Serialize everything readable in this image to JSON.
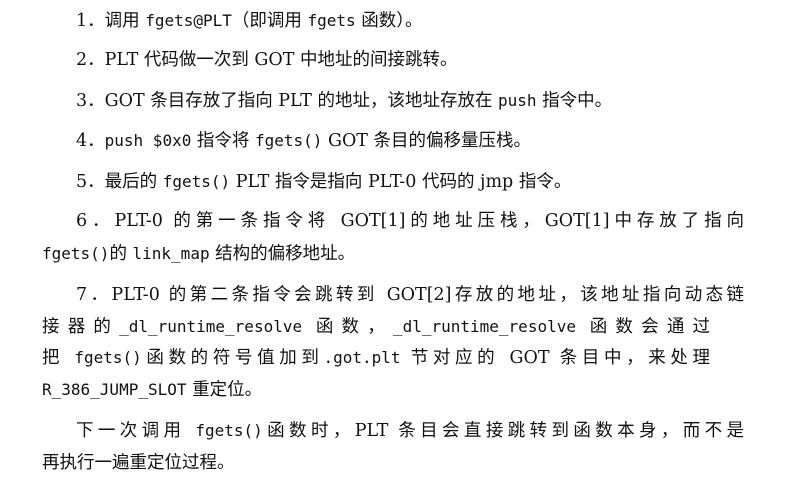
{
  "items": [
    {
      "lines": [
        [
          {
            "t": "1．调用 "
          },
          {
            "t": "fgets@PLT",
            "m": true
          },
          {
            "t": "（即调用 "
          },
          {
            "t": "fgets",
            "m": true
          },
          {
            "t": " 函数）。"
          }
        ]
      ]
    },
    {
      "lines": [
        [
          {
            "t": "2．PLT 代码做一次到 GOT 中地址的间接跳转。"
          }
        ]
      ]
    },
    {
      "lines": [
        [
          {
            "t": "3．GOT 条目存放了指向 PLT 的地址，该地址存放在 "
          },
          {
            "t": "push",
            "m": true
          },
          {
            "t": " 指令中。"
          }
        ]
      ]
    },
    {
      "lines": [
        [
          {
            "t": "4．"
          },
          {
            "t": "push $0x0",
            "m": true
          },
          {
            "t": " 指令将 "
          },
          {
            "t": "fgets()",
            "m": true
          },
          {
            "t": " GOT 条目的偏移量压栈。"
          }
        ]
      ]
    },
    {
      "lines": [
        [
          {
            "t": "5．最后的 "
          },
          {
            "t": "fgets()",
            "m": true
          },
          {
            "t": " PLT 指令是指向 PLT-0 代码的 jmp 指令。"
          }
        ]
      ]
    },
    {
      "lines": [
        [
          {
            "t": "6．PLT-0 的第一条指令将 GOT[1]的地址压栈，GOT[1]中存放了指向"
          }
        ],
        [
          {
            "t": "fgets()",
            "m": true
          },
          {
            "t": "的 "
          },
          {
            "t": "link_map",
            "m": true
          },
          {
            "t": " 结构的偏移地址。"
          }
        ]
      ]
    },
    {
      "lines": [
        [
          {
            "t": "7．PLT-0 的第二条指令会跳转到 GOT[2]存放的地址，该地址指向动态链"
          }
        ],
        [
          {
            "t": "接器的"
          },
          {
            "t": "_dl_runtime_resolve",
            "m": true
          },
          {
            "t": " 函数，"
          },
          {
            "t": "_dl_runtime_resolve",
            "m": true
          },
          {
            "t": " 函数会通过"
          }
        ],
        [
          {
            "t": "把 "
          },
          {
            "t": "fgets()",
            "m": true
          },
          {
            "t": "函数的符号值加到"
          },
          {
            "t": ".got.plt",
            "m": true
          },
          {
            "t": " 节对应的 GOT 条目中，来处理"
          }
        ],
        [
          {
            "t": "R_386_JUMP_SLOT",
            "m": true
          },
          {
            "t": " 重定位。"
          }
        ]
      ]
    },
    {
      "lines": [
        [
          {
            "t": "下一次调用 "
          },
          {
            "t": "fgets()",
            "m": true
          },
          {
            "t": "函数时，PLT 条目会直接跳转到函数本身，而不是"
          }
        ],
        [
          {
            "t": "再执行一遍重定位过程。"
          }
        ]
      ]
    }
  ]
}
